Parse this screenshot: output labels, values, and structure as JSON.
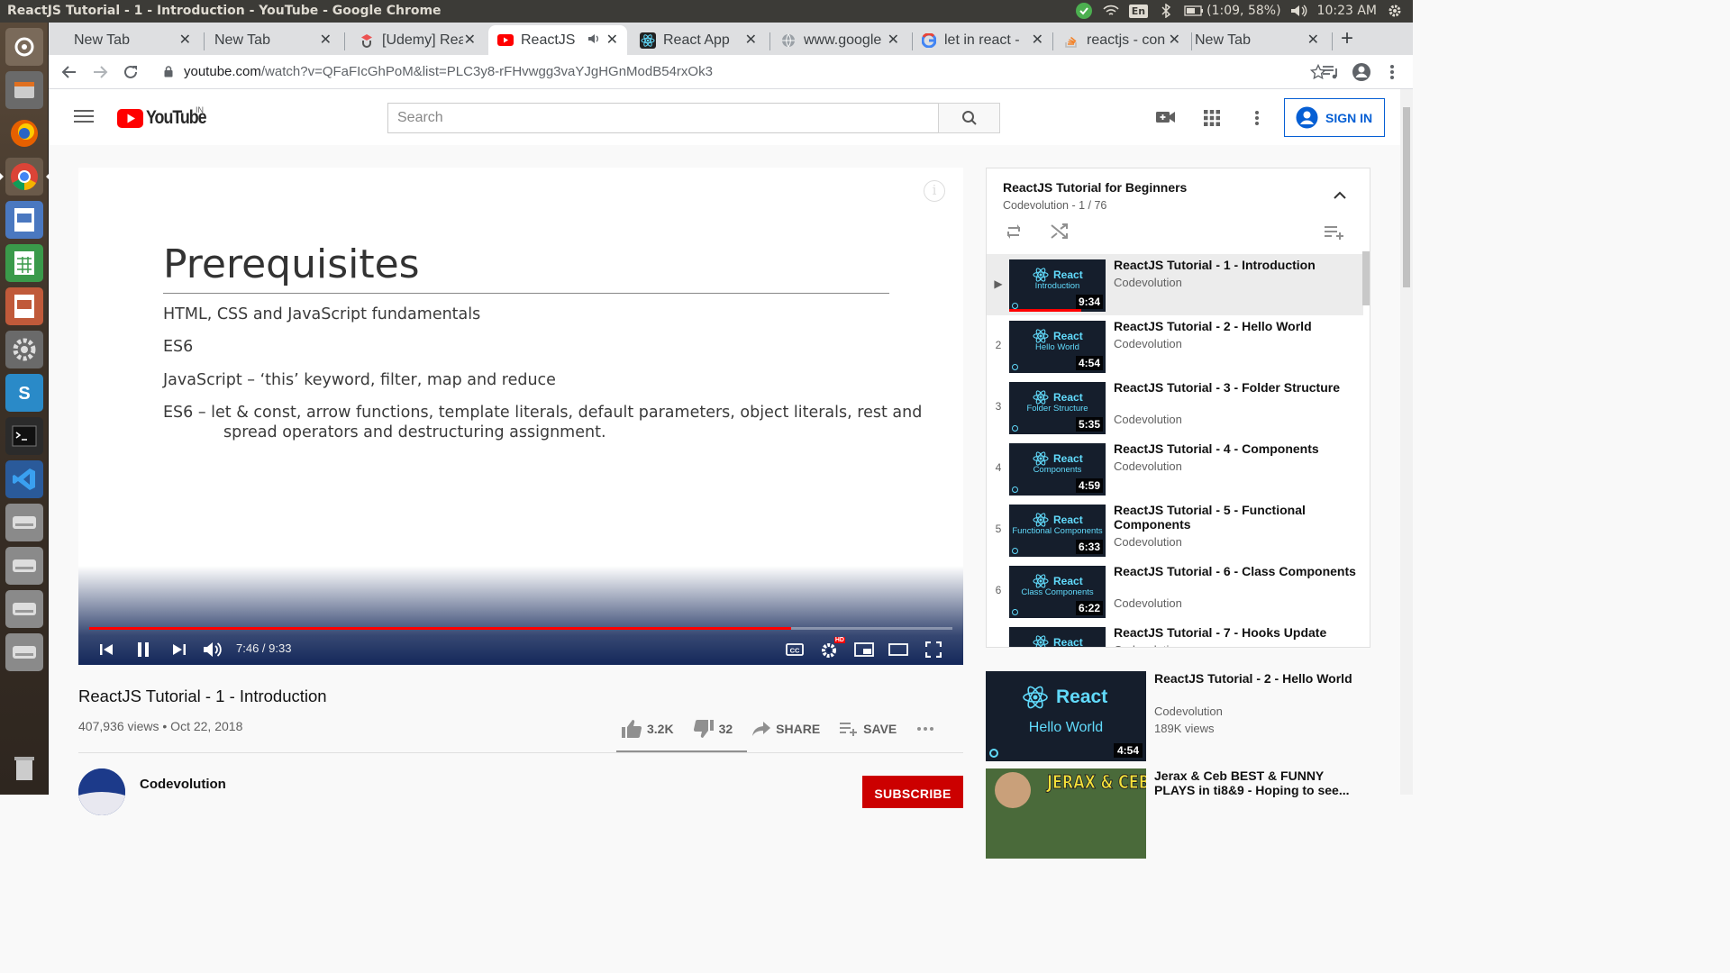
{
  "os": {
    "window_title": "ReactJS Tutorial - 1 - Introduction - YouTube - Google Chrome",
    "battery": "(1:09, 58%)",
    "keyboard_layout": "En",
    "clock": "10:23 AM"
  },
  "tabs": [
    {
      "label": "New Tab",
      "favicon": "none",
      "active": false
    },
    {
      "label": "New Tab",
      "favicon": "none",
      "active": false
    },
    {
      "label": "[Udemy] Rea",
      "favicon": "udemy-icon",
      "active": false
    },
    {
      "label": "ReactJS",
      "favicon": "youtube-icon",
      "active": true,
      "audio": true
    },
    {
      "label": "React App",
      "favicon": "react-icon",
      "active": false
    },
    {
      "label": "www.google",
      "favicon": "globe-icon",
      "active": false
    },
    {
      "label": "let in react -",
      "favicon": "google-icon",
      "active": false
    },
    {
      "label": "reactjs - con",
      "favicon": "stackoverflow-icon",
      "active": false
    },
    {
      "label": "New Tab",
      "favicon": "none",
      "active": false
    }
  ],
  "toolbar": {
    "url_host": "youtube.com",
    "url_path": "/watch?v=QFaFIcGhPoM&list=PLC3y8-rFHvwgg3vaYJgHGnModB54rxOk3"
  },
  "youtube": {
    "logo_text": "YouTube",
    "country_code": "IN",
    "search_placeholder": "Search",
    "sign_in_label": "SIGN IN"
  },
  "slide": {
    "title": "Prerequisites",
    "lines": [
      "HTML, CSS and JavaScript fundamentals",
      "ES6",
      "JavaScript – ‘this’ keyword, filter, map and reduce",
      "ES6 – let & const, arrow functions, template literals, default parameters, object literals, rest and",
      "spread operators and destructuring assignment."
    ]
  },
  "player": {
    "time": "7:46 / 9:33",
    "progress_fraction": 0.813,
    "hd_badge": "HD",
    "info_glyph": "i"
  },
  "video": {
    "title": "ReactJS Tutorial - 1 - Introduction",
    "meta": "407,936 views • Oct 22, 2018",
    "likes": "3.2K",
    "dislikes": "32",
    "share_label": "SHARE",
    "save_label": "SAVE",
    "channel": "Codevolution",
    "subscribe_label": "SUBSCRIBE"
  },
  "playlist": {
    "title": "ReactJS Tutorial for Beginners",
    "subtitle": "Codevolution - 1 / 76",
    "items": [
      {
        "index": "▶",
        "title": "ReactJS Tutorial - 1 - Introduction",
        "channel": "Codevolution",
        "thumb_brand": "React",
        "thumb_sub": "Introduction",
        "duration": "9:34",
        "current": true,
        "watched_fraction": 0.75
      },
      {
        "index": "2",
        "title": "ReactJS Tutorial - 2 - Hello World",
        "channel": "Codevolution",
        "thumb_brand": "React",
        "thumb_sub": "Hello World",
        "duration": "4:54",
        "current": false,
        "watched_fraction": 0
      },
      {
        "index": "3",
        "title": "ReactJS Tutorial - 3 - Folder Structure",
        "channel": "Codevolution",
        "thumb_brand": "React",
        "thumb_sub": "Folder Structure",
        "duration": "5:35",
        "current": false,
        "watched_fraction": 0
      },
      {
        "index": "4",
        "title": "ReactJS Tutorial - 4 - Components",
        "channel": "Codevolution",
        "thumb_brand": "React",
        "thumb_sub": "Components",
        "duration": "4:59",
        "current": false,
        "watched_fraction": 0
      },
      {
        "index": "5",
        "title": "ReactJS Tutorial - 5 - Functional Components",
        "channel": "Codevolution",
        "thumb_brand": "React",
        "thumb_sub": "Functional Components",
        "duration": "6:33",
        "current": false,
        "watched_fraction": 0
      },
      {
        "index": "6",
        "title": "ReactJS Tutorial - 6 - Class Components",
        "channel": "Codevolution",
        "thumb_brand": "React",
        "thumb_sub": "Class Components",
        "duration": "6:22",
        "current": false,
        "watched_fraction": 0
      },
      {
        "index": "",
        "title": "ReactJS Tutorial - 7 - Hooks Update",
        "channel": "Codevolution",
        "thumb_brand": "React",
        "thumb_sub": "",
        "duration": "",
        "current": false,
        "watched_fraction": 0
      }
    ]
  },
  "up_next": [
    {
      "title": "ReactJS Tutorial - 2 - Hello World",
      "channel": "Codevolution",
      "views": "189K views",
      "thumb_brand": "React",
      "thumb_sub": "Hello World",
      "duration": "4:54"
    },
    {
      "title": "Jerax & Ceb BEST & FUNNY PLAYS in ti8&9 - Hoping to see...",
      "channel": "",
      "views": "",
      "thumb_text": "JERAX & CEB",
      "duration": ""
    }
  ],
  "colors": {
    "youtube_red": "#ff0000",
    "react_cyan": "#61dafb",
    "signin_blue": "#065fd4",
    "subscribe_red": "#cc0000",
    "player_bar": "#14285a"
  }
}
